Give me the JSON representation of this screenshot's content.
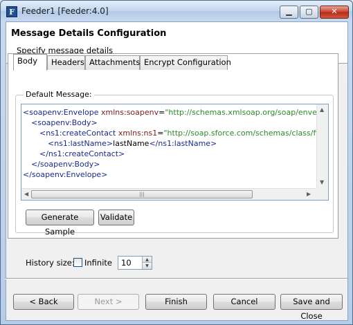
{
  "window": {
    "title": "Feeder1 [Feeder:4.0]",
    "icon_letter": "F",
    "buttons": {
      "minimize": "▁",
      "maximize": "▢",
      "close": "✕"
    }
  },
  "header": {
    "title": "Message Details Configuration",
    "subtitle": "Specify message details"
  },
  "tabs": [
    {
      "label": "Body",
      "active": true
    },
    {
      "label": "Headers",
      "active": false
    },
    {
      "label": "Attachments",
      "active": false
    },
    {
      "label": "Encrypt Configuration",
      "active": false
    }
  ],
  "body_tab": {
    "group_label": "Default Message:",
    "code": {
      "l1_open": "<soapenv:Envelope ",
      "l1_attr": "xmlns:soapenv",
      "l1_eq": "=",
      "l1_val": "\"http://schemas.xmlsoap.org/soap/envelo",
      "l2": "<soapenv:Body>",
      "l3_open": "<ns1:createContact ",
      "l3_attr": "xmlns:ns1",
      "l3_eq": "=",
      "l3_val": "\"http://soap.sforce.com/schemas/class/fio",
      "l4_open": "<ns1:lastName>",
      "l4_text": "lastName",
      "l4_close": "</ns1:lastName>",
      "l5": "</ns1:createContact>",
      "l6": "</soapenv:Body>",
      "l7": "</soapenv:Envelope>"
    },
    "generate_sample_label": "Generate Sample",
    "validate_label": "Validate"
  },
  "history": {
    "label": "History size:",
    "infinite_label": "Infinite",
    "infinite_checked": false,
    "value": "10"
  },
  "footer": {
    "back_label": "< Back",
    "next_label": "Next >",
    "finish_label": "Finish",
    "cancel_label": "Cancel",
    "save_close_label": "Save and Close"
  }
}
